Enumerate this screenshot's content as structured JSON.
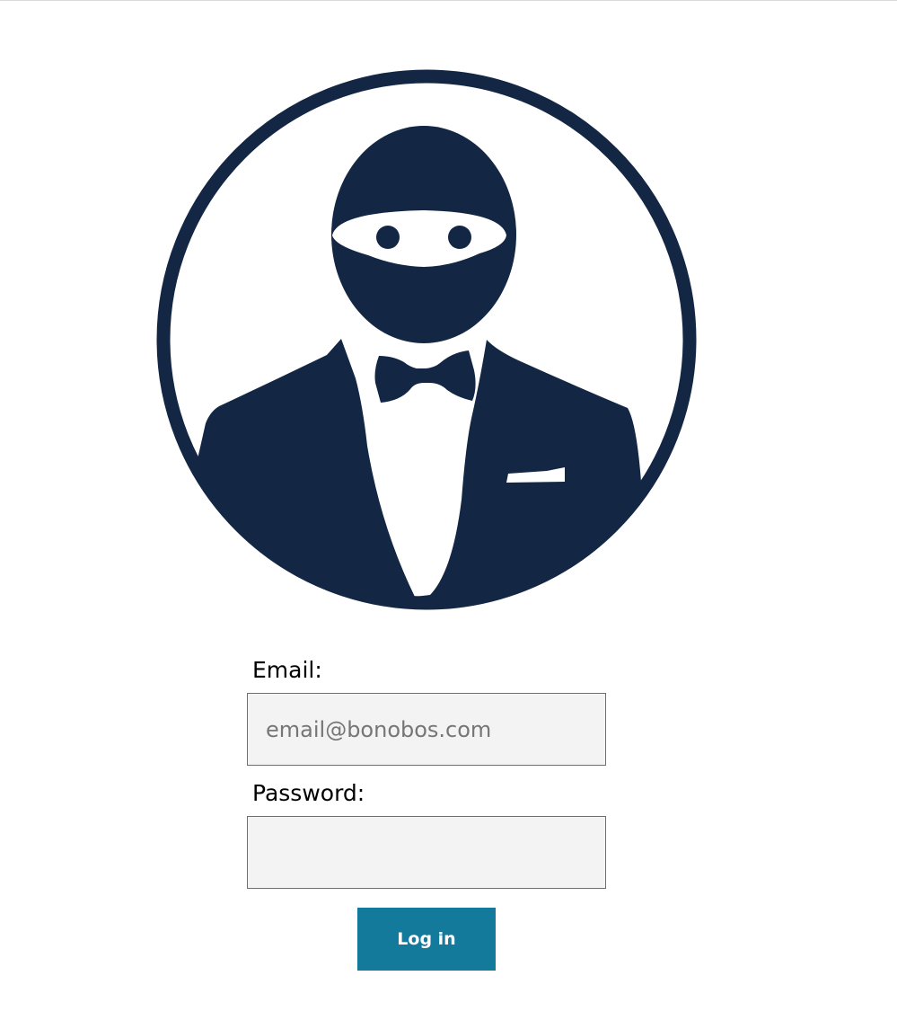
{
  "logo": {
    "icon": "ninja-tuxedo-logo",
    "color": "#132644"
  },
  "form": {
    "email": {
      "label": "Email:",
      "placeholder": "email@bonobos.com",
      "value": ""
    },
    "password": {
      "label": "Password:",
      "value": ""
    },
    "submit_label": "Log in",
    "submit_color": "#137a9c"
  }
}
